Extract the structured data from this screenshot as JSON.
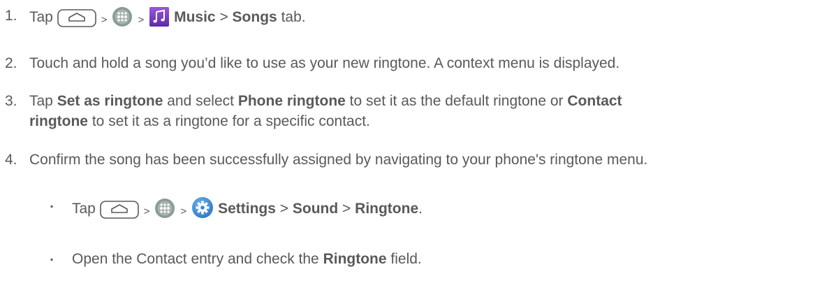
{
  "steps": [
    {
      "num": "1.",
      "tap": "Tap",
      "sep1": ">",
      "sep2": ">",
      "music": "Music",
      "sep3": ">",
      "songs": "Songs",
      "tab": "tab."
    },
    {
      "num": "2.",
      "text": "Touch and hold a song you’d like to use as your new ringtone. A context menu is displayed."
    },
    {
      "num": "3.",
      "tap": "Tap",
      "set_as_ringtone": "Set as ringtone",
      "and_select": "and select",
      "phone_ringtone": "Phone ringtone",
      "to_set_default": "to set it as the default ringtone or",
      "contact": "Contact",
      "ringtone": "ringtone",
      "to_set_specific": "to set it as a ringtone for a specific contact."
    },
    {
      "num": "4.",
      "text": "Confirm the song has been successfully assigned by navigating to your phone's ringtone menu."
    }
  ],
  "sub_items": [
    {
      "bullet": "▪",
      "tap": "Tap",
      "sep1": ">",
      "sep2": ">",
      "settings": "Settings",
      "sep3": ">",
      "sound": "Sound",
      "sep4": ">",
      "ringtone": "Ringtone",
      "period": "."
    },
    {
      "bullet": "▪",
      "open_text": "Open the Contact entry and check the",
      "ringtone": "Ringtone",
      "field": "field."
    }
  ],
  "icons": {
    "home": "home-key-icon",
    "apps": "apps-icon",
    "music": "music-app-icon",
    "settings": "settings-gear-icon"
  },
  "colors": {
    "text": "#595959",
    "music_icon": "#7b3fc4",
    "settings_icon": "#3e8fd8",
    "apps_icon": "#8a9a94"
  }
}
